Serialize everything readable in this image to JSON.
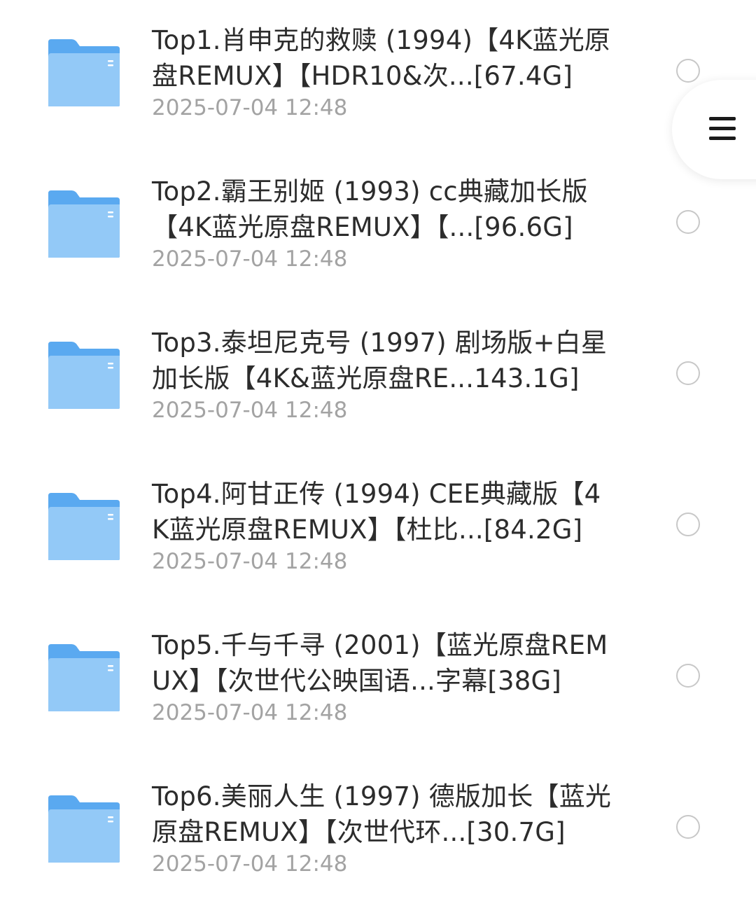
{
  "files": [
    {
      "name": "Top1.肖申克的救赎 (1994)【4K蓝光原盘REMUX】【HDR10&次...[67.4G]",
      "date": "2025-07-04 12:48"
    },
    {
      "name": "Top2.霸王别姬 (1993) cc典藏加长版【4K蓝光原盘REMUX】【...[96.6G]",
      "date": "2025-07-04 12:48"
    },
    {
      "name": "Top3.泰坦尼克号 (1997) 剧场版+白星加长版【4K&蓝光原盘RE...143.1G]",
      "date": "2025-07-04 12:48"
    },
    {
      "name": "Top4.阿甘正传 (1994) CEE典藏版【4K蓝光原盘REMUX】【杜比...[84.2G]",
      "date": "2025-07-04 12:48"
    },
    {
      "name": "Top5.千与千寻 (2001)【蓝光原盘REMUX】【次世代公映国语...字幕[38G]",
      "date": "2025-07-04 12:48"
    },
    {
      "name": "Top6.美丽人生 (1997) 德版加长【蓝光原盘REMUX】【次世代环...[30.7G]",
      "date": "2025-07-04 12:48"
    }
  ],
  "icons": {
    "folder": "folder-icon",
    "select": "radio-unchecked-icon",
    "menu": "menu-icon"
  },
  "colors": {
    "folder_back": "#5aa9f0",
    "folder_front": "#93c9f7",
    "text_primary": "#2c2c2c",
    "text_secondary": "#a3a3a3",
    "radio_border": "#c8c8c8"
  }
}
